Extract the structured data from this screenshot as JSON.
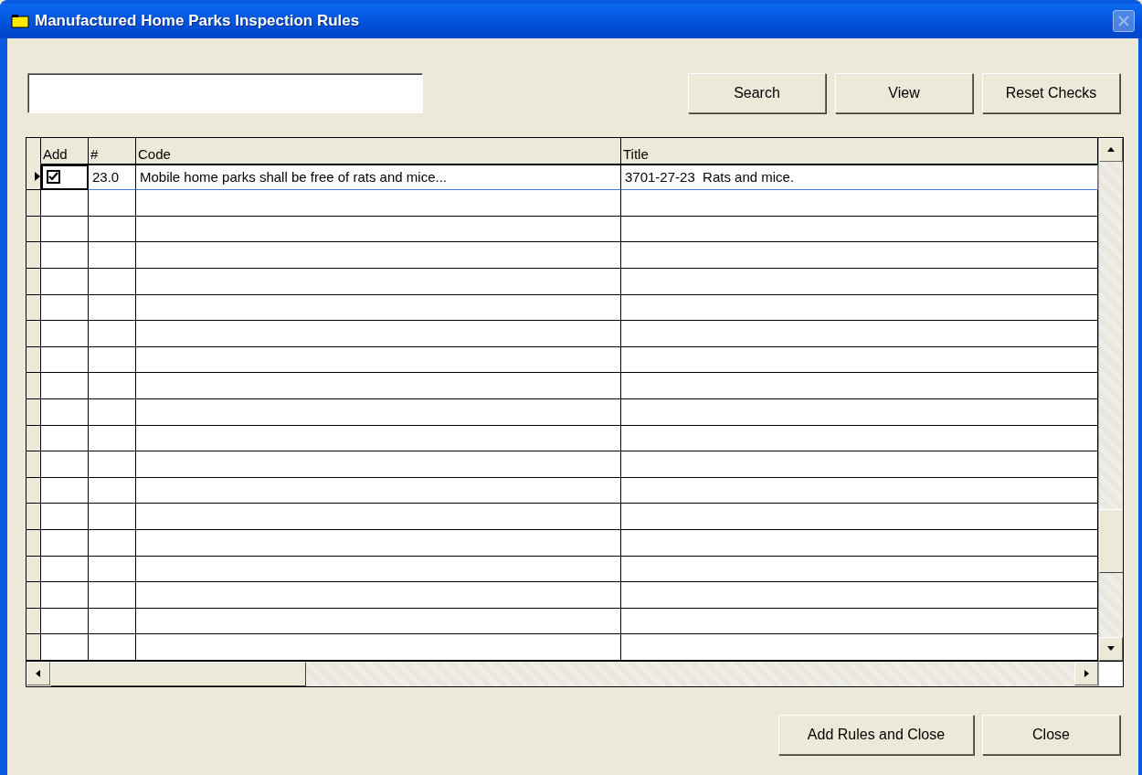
{
  "window": {
    "title": "Manufactured Home Parks Inspection Rules"
  },
  "top_buttons": [
    "Search",
    "View",
    "Reset Checks"
  ],
  "table": {
    "columns": [
      "Add",
      "#",
      "Code",
      "Title"
    ],
    "rows": [
      {
        "selected": true,
        "add": true,
        "number": "23.0",
        "code": "Mobile home parks shall be free of rats and mice...",
        "title": "3701-27-23  Rats and mice."
      }
    ]
  },
  "bottom_buttons": [
    "Add Rules and Close",
    "Close"
  ]
}
